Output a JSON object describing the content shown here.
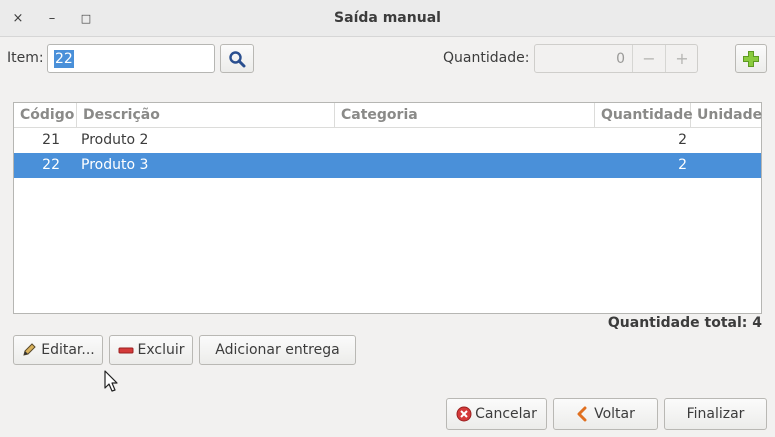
{
  "window": {
    "title": "Saída manual",
    "close_glyph": "×",
    "minimize_glyph": "–",
    "maximize_glyph": "□"
  },
  "item": {
    "label": "Item:",
    "value": "22"
  },
  "quantity": {
    "label": "Quantidade:",
    "value": "0",
    "minus": "−",
    "plus": "+"
  },
  "table": {
    "columns": [
      "Código",
      "Descrição",
      "Categoria",
      "Quantidade",
      "Unidade"
    ],
    "rows": [
      {
        "codigo": "21",
        "descricao": "Produto 2",
        "categoria": "",
        "quantidade": "2",
        "unidade": "",
        "selected": false
      },
      {
        "codigo": "22",
        "descricao": "Produto 3",
        "categoria": "",
        "quantidade": "2",
        "unidade": "",
        "selected": true
      }
    ]
  },
  "total": {
    "label": "Quantidade total: 4"
  },
  "actions": {
    "edit_label": "Editar...",
    "delete_label": "Excluir",
    "add_delivery_label": "Adicionar entrega"
  },
  "footer": {
    "cancel_label": "Cancelar",
    "back_label": "Voltar",
    "finish_label": "Finalizar"
  },
  "colors": {
    "selection": "#4a90d9",
    "add_icon": "#73b82a",
    "cancel_icon": "#d43a3a",
    "back_icon": "#e07020"
  }
}
